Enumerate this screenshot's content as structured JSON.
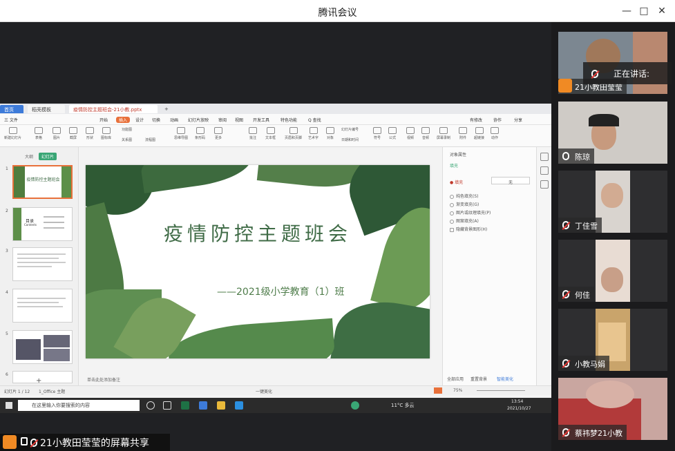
{
  "window": {
    "title": "腾讯会议"
  },
  "share_window": {
    "tabs": [
      "首页",
      "稻壳模板",
      "疫情防控主题班会-21小教.pptx"
    ],
    "menu": [
      "三 文件",
      "开始",
      "插入",
      "设计",
      "切换",
      "动画",
      "幻灯片放映",
      "审阅",
      "视图",
      "开发工具",
      "特色功能",
      "Q 查找"
    ],
    "menu_right": [
      "有修改",
      "协作",
      "分享"
    ],
    "ribbon": [
      "新建幻灯片",
      "表格",
      "图片",
      "截屏",
      "形状",
      "图标库",
      "功能图",
      "关系图",
      "流程图",
      "思维导图",
      "条形码",
      "更多",
      "批注",
      "文本框",
      "页眉和页脚",
      "艺术字",
      "对象",
      "幻灯片编号",
      "日期和时间",
      "符号",
      "公式",
      "视频",
      "音频",
      "屏幕录制",
      "附件",
      "超链接",
      "动作"
    ],
    "outline_tabs": [
      "大纲",
      "幻灯片"
    ],
    "slides": [
      "1",
      "2",
      "3",
      "4",
      "5",
      "6"
    ],
    "thumb1_title": "疫情防控主题班会",
    "thumb2_title": "目录",
    "thumb2_sub": "Contents",
    "slide": {
      "title": "疫情防控主题班会",
      "subtitle": "——2021级小学教育（1）班"
    },
    "notes_placeholder": "单击此处添加备注",
    "panel": {
      "header": "对象属性",
      "tab": "填充",
      "fill_label": "● 填充",
      "fill_value": "无",
      "options": [
        "纯色填充(S)",
        "渐变填充(G)",
        "图片或纹理填充(P)",
        "图案填充(A)",
        "隐藏背景图形(H)"
      ],
      "buttons": [
        "全部应用",
        "重置背景",
        "智能美化"
      ]
    },
    "status": {
      "slide_info": "幻灯片 1 / 12",
      "theme": "1_Office 主题",
      "beautify": "一键美化",
      "zoom": "75%"
    },
    "taskbar": {
      "search_placeholder": "在这里输入你要搜索的内容",
      "weather": "11°C 多云",
      "time": "13:54",
      "date": "2021/10/27"
    }
  },
  "presenter": {
    "text": "21小教田莹莹的屏幕共享"
  },
  "participants": {
    "speaking_label": "正在讲话:",
    "tiles": [
      {
        "name": "21小教田莹莹",
        "muted": true
      },
      {
        "name": "陈琼",
        "muted": false
      },
      {
        "name": "丁佳雪",
        "muted": true
      },
      {
        "name": "何佳",
        "muted": true
      },
      {
        "name": "小教马娟",
        "muted": true
      },
      {
        "name": "蔡祎梦21小教",
        "muted": true
      }
    ]
  }
}
